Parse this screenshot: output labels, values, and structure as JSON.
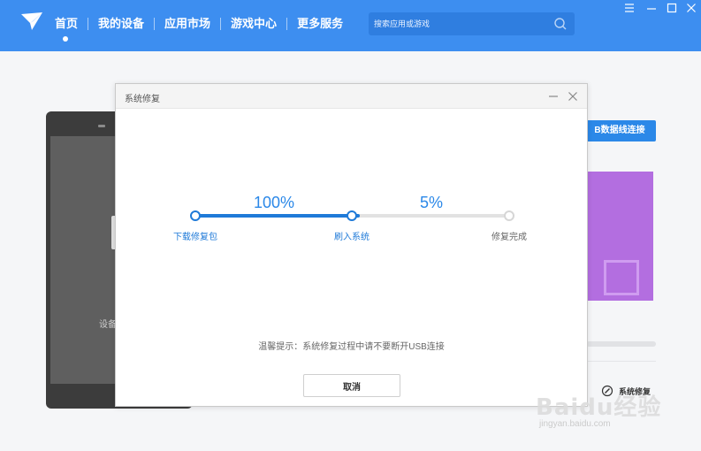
{
  "header": {
    "nav": [
      "首页",
      "我的设备",
      "应用市场",
      "游戏中心",
      "更多服务"
    ],
    "active_index": 0,
    "search_placeholder": "搜索应用或游戏"
  },
  "background": {
    "device_label": "设备",
    "usb_button_label": "B数据线连接",
    "repair_link_label": "系统修复"
  },
  "dialog": {
    "title": "系统修复",
    "steps": [
      {
        "label": "下载修复包",
        "status": "done"
      },
      {
        "label": "刷入系统",
        "status": "in-progress"
      },
      {
        "label": "修复完成",
        "status": "pending"
      }
    ],
    "progress": [
      {
        "percent_label": "100%",
        "value": 1.0
      },
      {
        "percent_label": "5%",
        "value": 0.05
      }
    ],
    "tip": "温馨提示：系统修复过程中请不要断开USB连接",
    "cancel_label": "取消"
  },
  "colors": {
    "accent": "#3d8ef0",
    "progress": "#1f7ad8",
    "track": "#e2e2e2",
    "promo": "#b36ee0"
  },
  "watermark": {
    "main": "Baidu经验",
    "sub": "jingyan.baidu.com"
  }
}
